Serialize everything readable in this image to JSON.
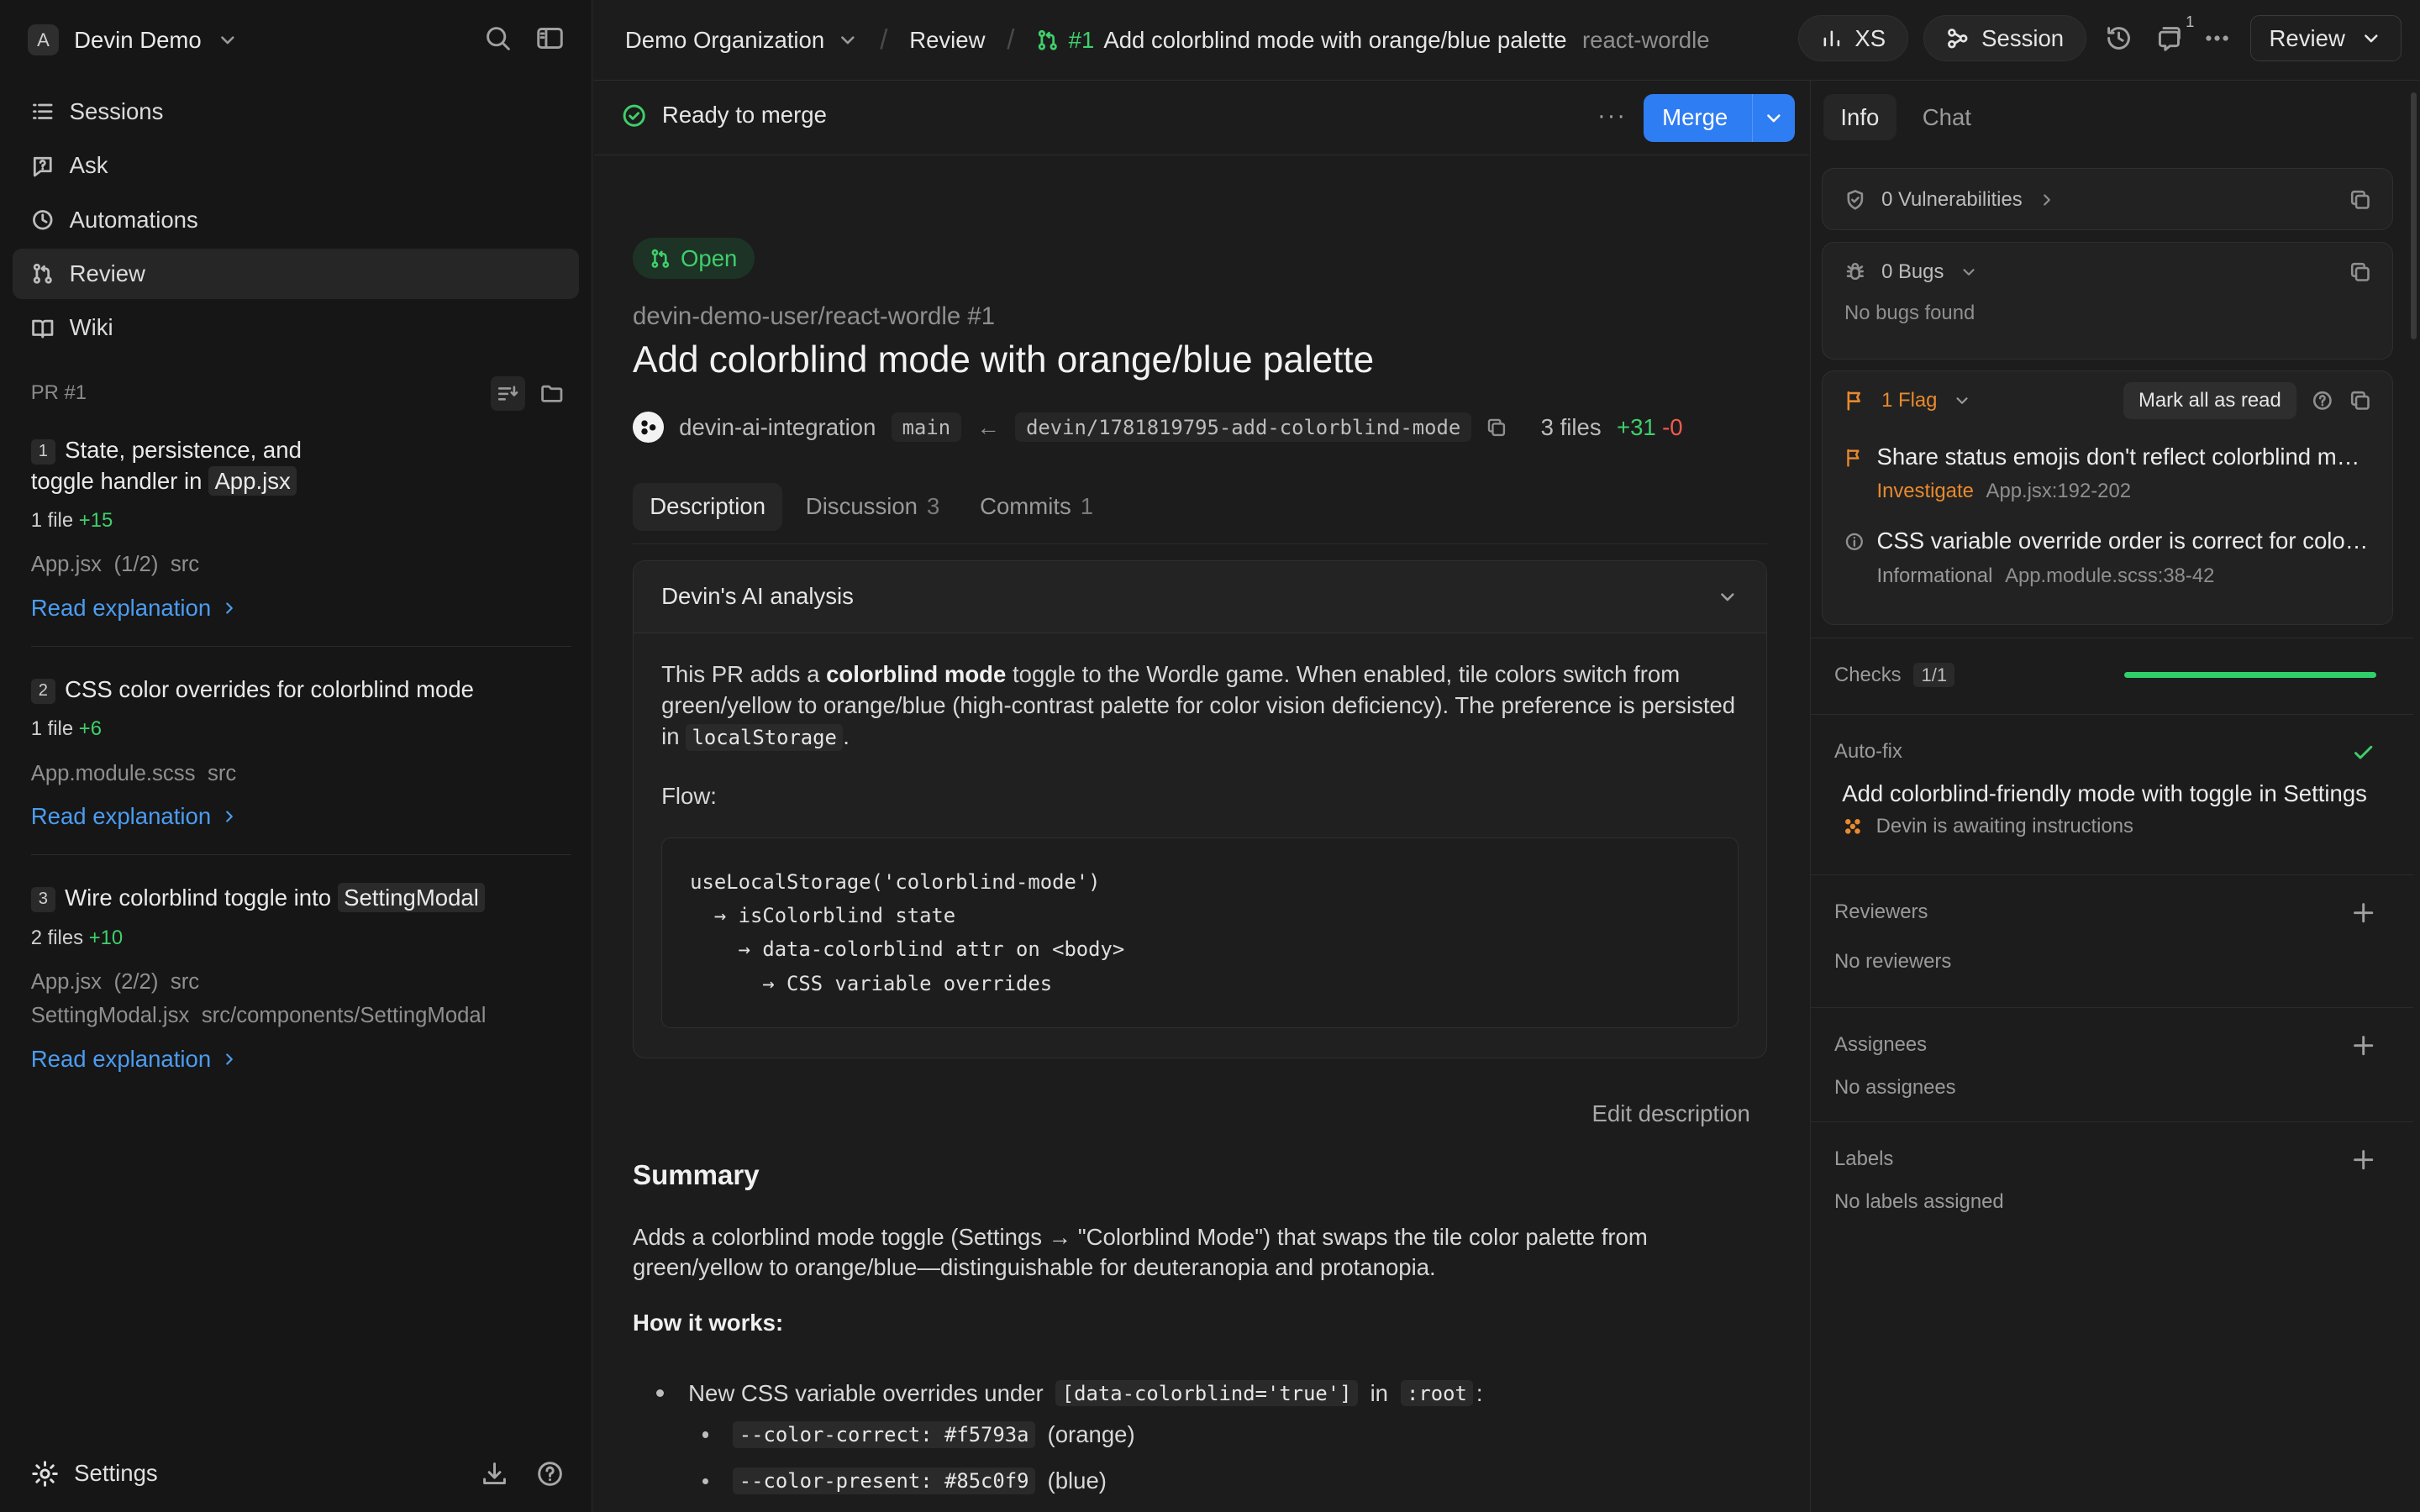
{
  "sidebar": {
    "workspace_initial": "A",
    "workspace_name": "Devin Demo",
    "nav": [
      {
        "label": "Sessions",
        "icon": "list-icon"
      },
      {
        "label": "Ask",
        "icon": "ask-icon"
      },
      {
        "label": "Automations",
        "icon": "clock-icon"
      },
      {
        "label": "Review",
        "icon": "pull-request-icon"
      },
      {
        "label": "Wiki",
        "icon": "book-icon"
      }
    ],
    "pr_label": "PR #1",
    "steps": [
      {
        "num": "1",
        "title_a": "State, persistence, and toggle handler in",
        "title_code": "App.jsx",
        "files": "1 file",
        "add": "+15",
        "file_list": [
          {
            "name": "App.jsx",
            "extra": "(1/2)",
            "dir": "src"
          }
        ],
        "link": "Read explanation"
      },
      {
        "num": "2",
        "title_a": "CSS color overrides for colorblind mode",
        "title_code": "",
        "files": "1 file",
        "add": "+6",
        "file_list": [
          {
            "name": "App.module.scss",
            "extra": "",
            "dir": "src"
          }
        ],
        "link": "Read explanation"
      },
      {
        "num": "3",
        "title_a": "Wire colorblind toggle into",
        "title_code": "SettingModal",
        "files": "2 files",
        "add": "+10",
        "file_list": [
          {
            "name": "App.jsx",
            "extra": "(2/2)",
            "dir": "src"
          },
          {
            "name": "SettingModal.jsx",
            "extra": "",
            "dir": "src/components/SettingModal"
          }
        ],
        "link": "Read explanation"
      }
    ],
    "settings_label": "Settings"
  },
  "topbar": {
    "org": "Demo Organization",
    "section": "Review",
    "pr_number": "#1",
    "pr_title": "Add colorblind mode with orange/blue palette",
    "repo": "react-wordle",
    "size_pill": "XS",
    "session_pill": "Session",
    "notif_count": "1",
    "review_button": "Review"
  },
  "main": {
    "status": "Ready to merge",
    "merge_button": "Merge",
    "open_badge": "Open",
    "repo_line": "devin-demo-user/react-wordle #1",
    "title": "Add colorblind mode with orange/blue palette",
    "author": "devin-ai-integration",
    "base_branch": "main",
    "head_branch": "devin/1781819795-add-colorblind-mode",
    "files": "3 files",
    "additions": "+31",
    "deletions": "-0",
    "tabs": [
      {
        "label": "Description",
        "count": ""
      },
      {
        "label": "Discussion",
        "count": "3"
      },
      {
        "label": "Commits",
        "count": "1"
      }
    ],
    "ai": {
      "title": "Devin's AI analysis",
      "p_a": "This PR adds a ",
      "p_bold": "colorblind mode",
      "p_b": " toggle to the Wordle game. When enabled, tile colors switch from green/yellow to orange/blue (high-contrast palette for color vision deficiency). The preference is persisted in ",
      "p_code": "localStorage",
      "p_c": ".",
      "flow_label": "Flow:",
      "code": "useLocalStorage('colorblind-mode')\n  → isColorblind state\n    → data-colorblind attr on <body>\n      → CSS variable overrides"
    },
    "edit_description": "Edit description",
    "summary_title": "Summary",
    "summary_text": "Adds a colorblind mode toggle (Settings → \"Colorblind Mode\") that swaps the tile color palette from green/yellow to orange/blue—distinguishable for deuteranopia and protanopia.",
    "how_title": "How it works:",
    "bullet1_a": "New CSS variable overrides under ",
    "bullet1_code1": "[data-colorblind='true']",
    "bullet1_b": " in ",
    "bullet1_code2": ":root",
    "bullet1_c": ":",
    "sub1_code": "--color-correct: #f5793a",
    "sub1_text": "(orange)",
    "sub2_code": "--color-present: #85c0f9",
    "sub2_text": "(blue)"
  },
  "right": {
    "tabs": [
      "Info",
      "Chat"
    ],
    "vulnerabilities": "0 Vulnerabilities",
    "bugs": "0 Bugs",
    "bugs_empty": "No bugs found",
    "flags": "1 Flag",
    "mark_all": "Mark all as read",
    "flag_items": [
      {
        "title": "Share status emojis don't reflect colorblind mode",
        "tag": "Investigate",
        "loc": "App.jsx:192-202"
      },
      {
        "title": "CSS variable override order is correct for colorblind mode",
        "tag": "Informational",
        "loc": "App.module.scss:38-42"
      }
    ],
    "checks_label": "Checks",
    "checks_count": "1/1",
    "checks_progress": 1.0,
    "autofix_label": "Auto-fix",
    "autofix_title": "Add colorblind-friendly mode with toggle in Settings",
    "autofix_status": "Devin is awaiting instructions",
    "reviewers_label": "Reviewers",
    "reviewers_empty": "No reviewers",
    "assignees_label": "Assignees",
    "assignees_empty": "No assignees",
    "labels_label": "Labels",
    "labels_empty": "No labels assigned"
  },
  "colors": {
    "accent": "#2f7df2",
    "success": "#3fcf6b",
    "flag": "#e88a2e",
    "danger": "#f25a4f"
  }
}
